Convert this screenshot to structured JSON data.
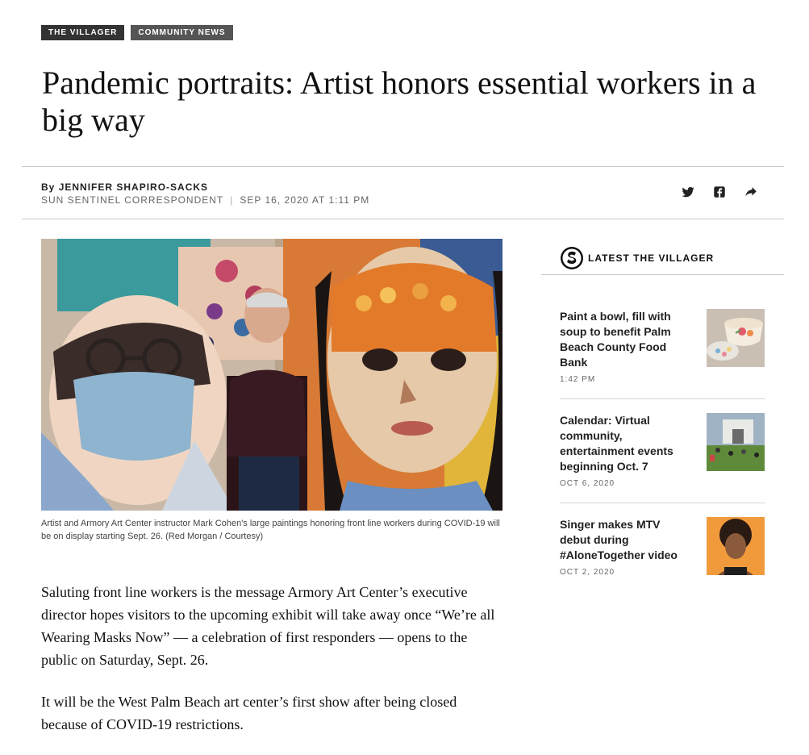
{
  "tags": [
    "THE VILLAGER",
    "COMMUNITY NEWS"
  ],
  "headline": "Pandemic portraits: Artist honors essential workers in a big way",
  "byline": {
    "prefix": "By",
    "author": "JENNIFER SHAPIRO-SACKS",
    "role": "SUN SENTINEL CORRESPONDENT",
    "separator": "|",
    "date": "SEP 16, 2020 AT 1:11 PM"
  },
  "share": {
    "icons": [
      "twitter-icon",
      "facebook-icon",
      "share-arrow-icon"
    ]
  },
  "hero": {
    "caption": "Artist and Armory Art Center instructor Mark Cohen's large paintings honoring front line workers during COVID-19 will be on display starting Sept. 26. (Red Morgan / Courtesy)"
  },
  "body": {
    "paragraphs": [
      "Saluting front line workers is the message Armory Art Center’s executive director hopes visitors to the upcoming exhibit will take away once “We’re all Wearing Masks Now” — a celebration of first responders — opens to the public on Saturday, Sept. 26.",
      "It will be the West Palm Beach art center’s first show after being closed because of COVID-19 restrictions."
    ]
  },
  "sidebar": {
    "title": "LATEST THE VILLAGER",
    "items": [
      {
        "headline": "Paint a bowl, fill with soup to benefit Palm Beach County Food Bank",
        "time": "1:42 PM"
      },
      {
        "headline": "Calendar: Virtual community, entertainment events beginning Oct. 7",
        "time": "OCT 6, 2020"
      },
      {
        "headline": "Singer makes MTV debut during #AloneTogether video",
        "time": "OCT 2, 2020"
      }
    ]
  },
  "colors": {
    "tag_bg": "#333333",
    "rule": "#c9c9c9",
    "text": "#111111",
    "meta": "#666666"
  }
}
